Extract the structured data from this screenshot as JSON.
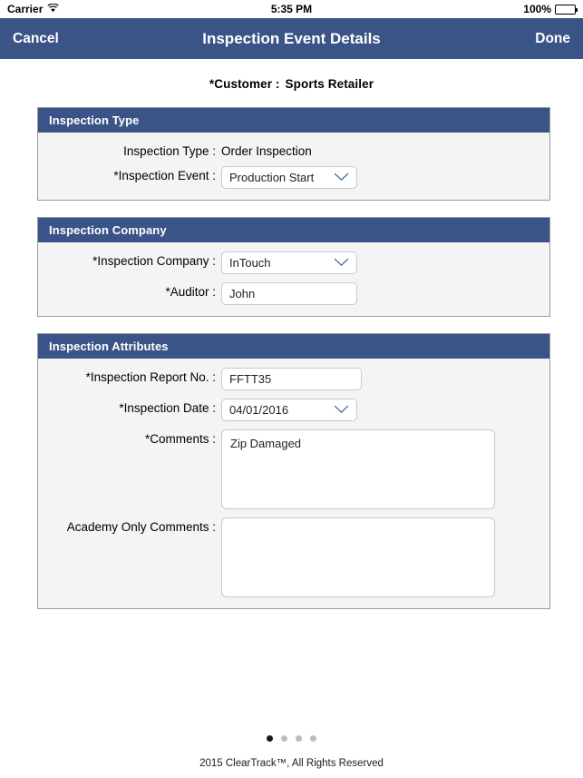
{
  "status_bar": {
    "carrier": "Carrier",
    "wifi_icon": "wifi-icon",
    "time": "5:35 PM",
    "battery_percent": "100%",
    "battery_icon": "battery-full-icon"
  },
  "nav_bar": {
    "cancel_label": "Cancel",
    "title": "Inspection Event Details",
    "done_label": "Done",
    "background_color": "#3b5487"
  },
  "customer": {
    "label": "*Customer :",
    "value": "Sports Retailer"
  },
  "sections": [
    {
      "title": "Inspection Type",
      "fields": [
        {
          "label": "Inspection Type :",
          "type": "static",
          "value": "Order Inspection"
        },
        {
          "label": "*Inspection Event :",
          "type": "select",
          "value": "Production Start"
        }
      ]
    },
    {
      "title": "Inspection Company",
      "fields": [
        {
          "label": "*Inspection Company :",
          "type": "select",
          "value": "InTouch"
        },
        {
          "label": "*Auditor :",
          "type": "text",
          "value": "John"
        }
      ]
    },
    {
      "title": "Inspection Attributes",
      "fields": [
        {
          "label": "*Inspection Report No. :",
          "type": "text",
          "value": "FFTT35"
        },
        {
          "label": "*Inspection Date :",
          "type": "select",
          "value": "04/01/2016"
        },
        {
          "label": "*Comments :",
          "type": "textarea",
          "value": "Zip Damaged"
        },
        {
          "label": "Academy Only Comments :",
          "type": "textarea",
          "value": ""
        }
      ]
    }
  ],
  "footer": {
    "page_dots": {
      "count": 4,
      "active_index": 0
    },
    "copyright": "2015 ClearTrack™, All Rights Reserved"
  },
  "colors": {
    "brand_blue": "#3b5487",
    "panel_bg": "#f4f4f4",
    "panel_border": "#9a9a9a",
    "chevron_blue": "#4a6ea8"
  }
}
